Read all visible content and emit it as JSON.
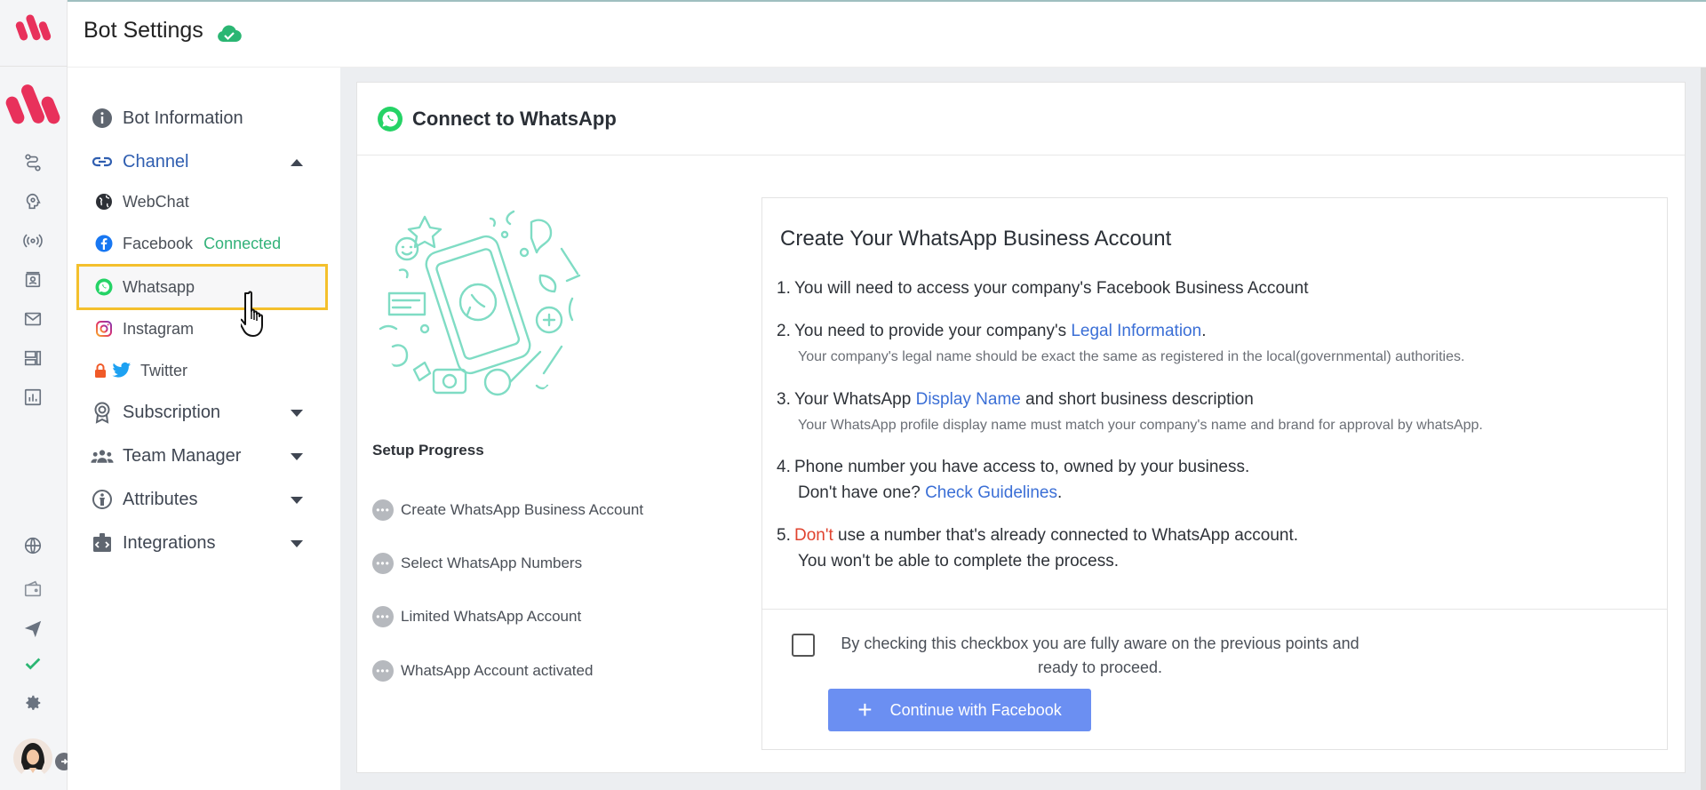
{
  "header": {
    "title": "Bot Settings",
    "status_icon": "cloud-check-icon"
  },
  "nav": {
    "bot_information": "Bot Information",
    "channel": "Channel",
    "channels": {
      "webchat": "WebChat",
      "facebook": "Facebook",
      "facebook_status": "Connected",
      "whatsapp": "Whatsapp",
      "instagram": "Instagram",
      "twitter": "Twitter"
    },
    "subscription": "Subscription",
    "team_manager": "Team Manager",
    "attributes": "Attributes",
    "integrations": "Integrations"
  },
  "card": {
    "title": "Connect to WhatsApp",
    "setup_progress": "Setup Progress",
    "steps": [
      "Create WhatsApp Business Account",
      "Select WhatsApp Numbers",
      "Limited WhatsApp Account",
      "WhatsApp Account activated"
    ]
  },
  "info": {
    "title": "Create Your WhatsApp Business Account",
    "p1_num": "1.",
    "p1": "You will need to access your company's Facebook Business Account",
    "p2_num": "2.",
    "p2_pre": "You need to provide your company's ",
    "p2_link": "Legal Information",
    "p2_post": ".",
    "p2_note": "Your company's legal name should be exact the same as registered in the local(governmental) authorities.",
    "p3_num": "3.",
    "p3_pre": "Your WhatsApp ",
    "p3_link": "Display Name",
    "p3_post": " and short business description",
    "p3_note": "Your WhatsApp profile display name must match your company's name and brand for approval by whatsApp.",
    "p4_num": "4.",
    "p4_line1": "Phone number you have access to, owned by your business.",
    "p4_pre": "Don't have one? ",
    "p4_link": "Check Guidelines",
    "p4_post": ".",
    "p5_num": "5.",
    "p5_red": "Don't",
    "p5_rest": " use a number that's already connected to WhatsApp account.",
    "p5_line2": "You won't be able to complete the process.",
    "checkbox_text": "By checking this checkbox you are fully aware on the previous points and ready to proceed.",
    "button": "Continue with Facebook"
  },
  "colors": {
    "brand": "#e8315b",
    "link": "#3b6fd6",
    "highlight": "#f4c02c",
    "button": "#6b8ff2",
    "connected": "#33b27a",
    "whatsapp": "#25d366"
  }
}
